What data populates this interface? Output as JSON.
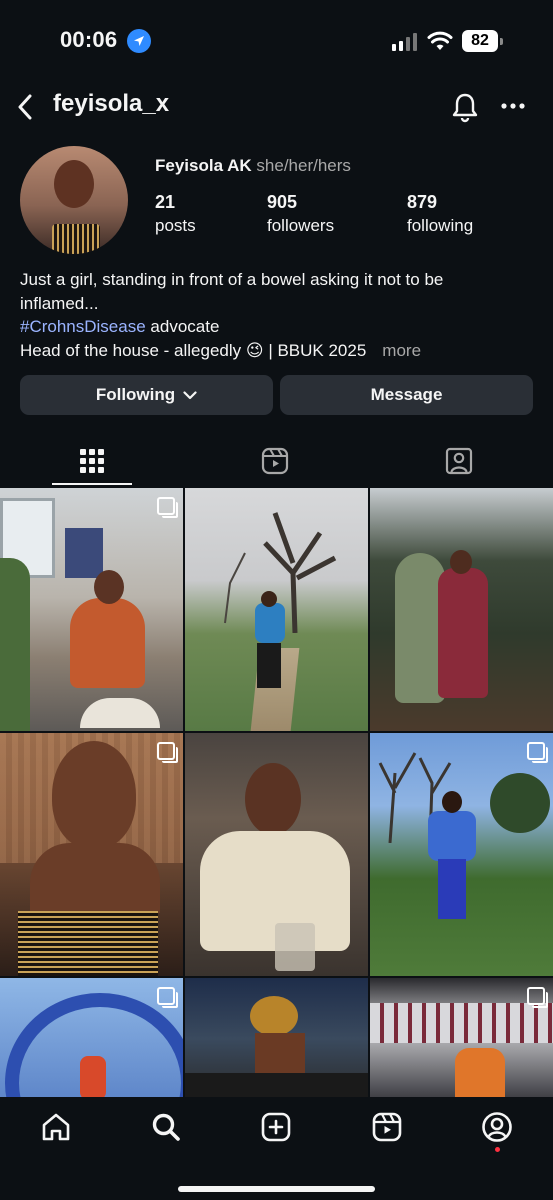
{
  "status": {
    "time": "00:06",
    "battery": "82"
  },
  "header": {
    "username": "feyisola_x"
  },
  "profile": {
    "name": "Feyisola AK",
    "pronouns": "she/her/hers",
    "stats": [
      {
        "value": "21",
        "label": "posts"
      },
      {
        "value": "905",
        "label": "followers"
      },
      {
        "value": "879",
        "label": "following"
      }
    ],
    "bio": {
      "line1": "Just a girl, standing in front of a bowel asking it not to be",
      "line2": "inflamed...",
      "hashtag": "#CrohnsDisease",
      "line3_rest": " advocate",
      "line4": "Head of the house - allegedly 😉 | BBUK 2025",
      "more": "more"
    }
  },
  "actions": {
    "following": "Following",
    "message": "Message"
  },
  "tabs": [
    "grid-icon",
    "reels-icon",
    "tagged-icon"
  ],
  "grid": [
    {
      "multi": true
    },
    {
      "multi": false
    },
    {
      "multi": false
    },
    {
      "multi": true
    },
    {
      "multi": false
    },
    {
      "multi": true
    },
    {
      "multi": true
    },
    {
      "multi": false
    },
    {
      "multi": true
    }
  ],
  "nav": [
    "home-icon",
    "search-icon",
    "create-icon",
    "reels-icon",
    "profile-icon"
  ],
  "colors": {
    "background": "#0c1014",
    "button": "#2a2f36",
    "hashtag": "#9bb4ff",
    "location": "#2f8bff",
    "notification": "#ff3040"
  }
}
